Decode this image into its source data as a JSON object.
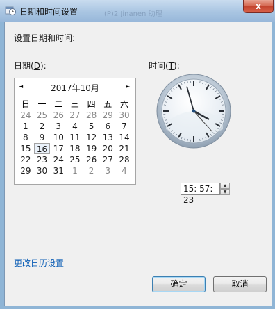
{
  "window": {
    "title": "日期和时间设置",
    "close_symbol": "x",
    "background_text": "(P)2 Jinanen 助理"
  },
  "dialog": {
    "heading": "设置日期和时间:",
    "date_label_pre": "日期(",
    "date_label_key": "D",
    "date_label_post": "):",
    "time_label_pre": "时间(",
    "time_label_key": "T",
    "time_label_post": "):",
    "change_calendar_link": "更改日历设置"
  },
  "calendar": {
    "month_title": "2017年10月",
    "prev_symbol": "◄",
    "next_symbol": "►",
    "weekdays": [
      "日",
      "一",
      "二",
      "三",
      "四",
      "五",
      "六"
    ],
    "weeks": [
      [
        "24",
        "25",
        "26",
        "27",
        "28",
        "29",
        "30"
      ],
      [
        "1",
        "2",
        "3",
        "4",
        "5",
        "6",
        "7"
      ],
      [
        "8",
        "9",
        "10",
        "11",
        "12",
        "13",
        "14"
      ],
      [
        "15",
        "16",
        "17",
        "18",
        "19",
        "20",
        "21"
      ],
      [
        "22",
        "23",
        "24",
        "25",
        "26",
        "27",
        "28"
      ],
      [
        "29",
        "30",
        "31",
        "1",
        "2",
        "3",
        "4"
      ]
    ],
    "selected_day": "16"
  },
  "clock": {
    "hours": 15,
    "minutes": 57,
    "seconds": 23
  },
  "time": {
    "value": "15: 57: 23",
    "up_symbol": "▲",
    "down_symbol": "▼"
  },
  "buttons": {
    "ok": "确定",
    "cancel": "取消"
  },
  "colors": {
    "link": "#0a5db5",
    "title_bar": "#a9c5e2",
    "close_button": "#c2432d"
  }
}
